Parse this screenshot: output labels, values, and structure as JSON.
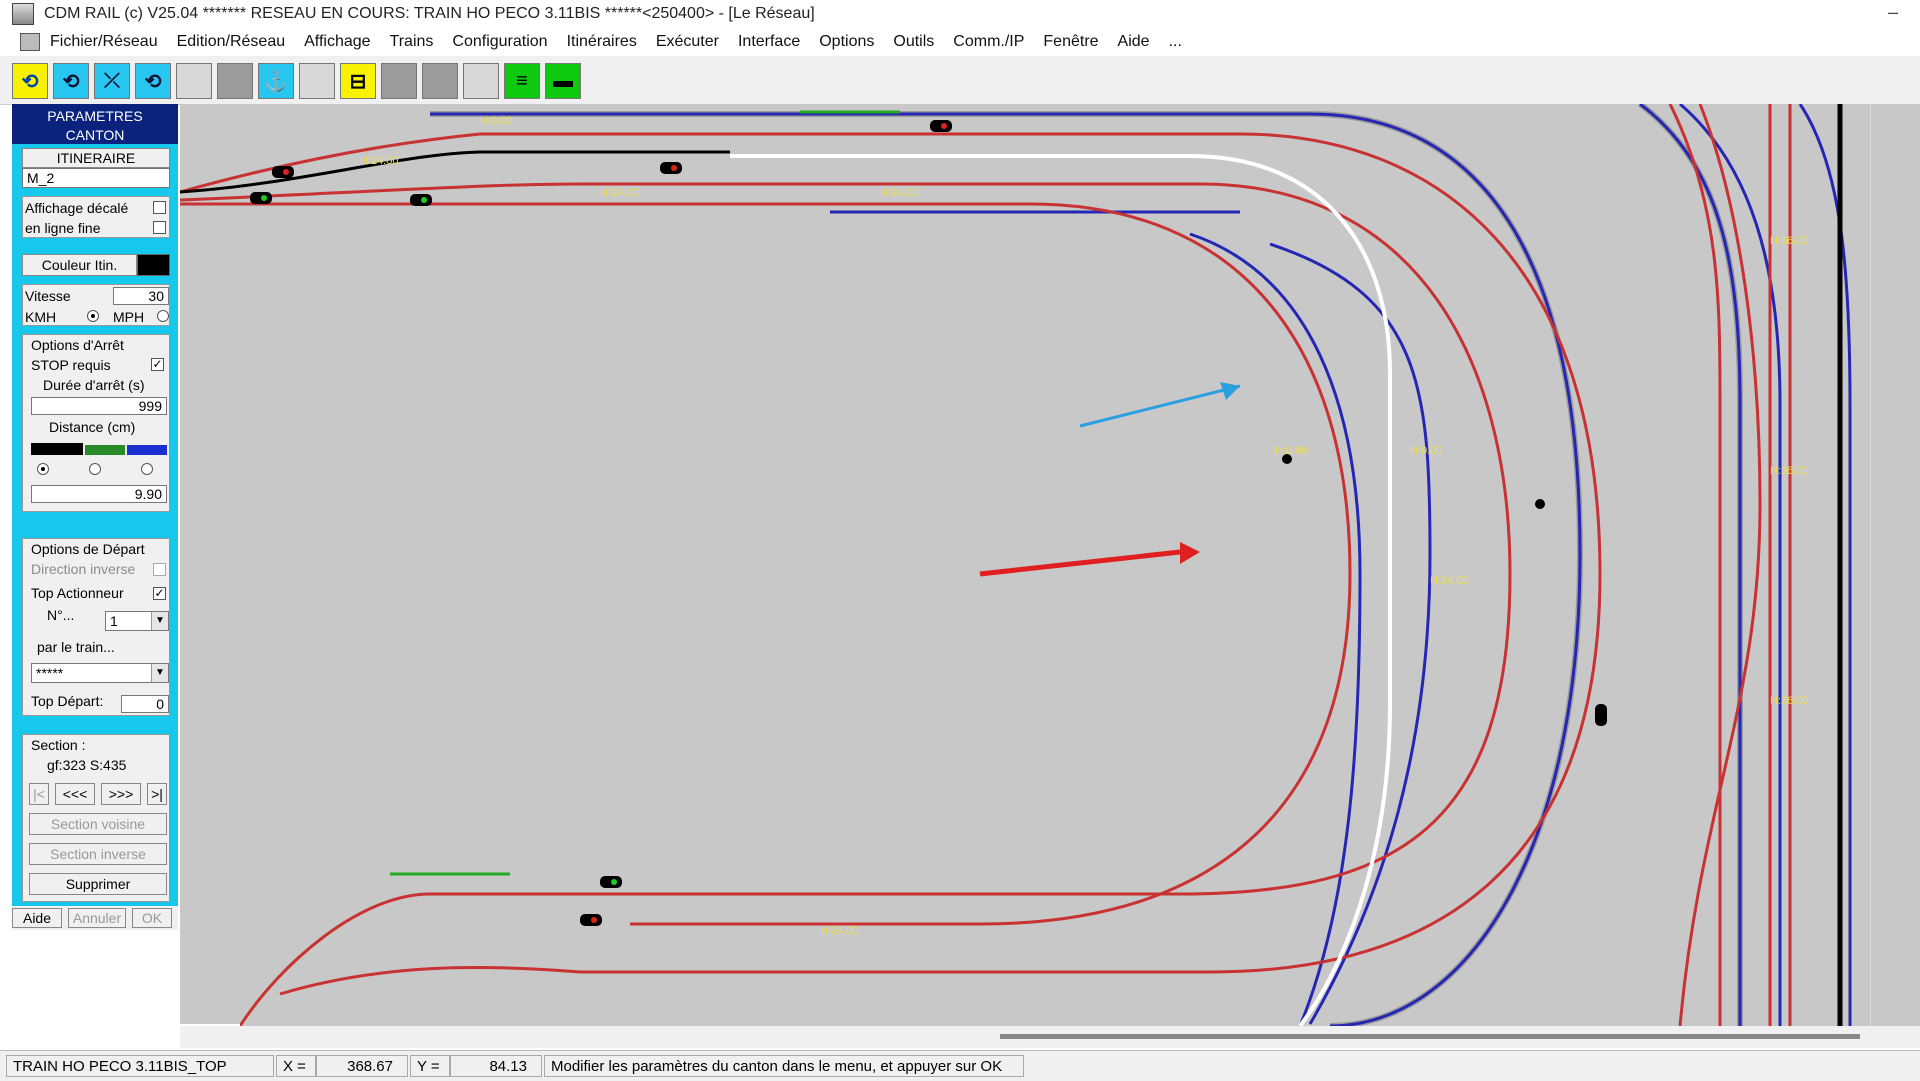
{
  "window": {
    "title": "CDM RAIL (c) V25.04     ******* RESEAU EN COURS: TRAIN HO PECO 3.11BIS ******<250400> - [Le Réseau]",
    "minimize": "–"
  },
  "menu": [
    "Fichier/Réseau",
    "Edition/Réseau",
    "Affichage",
    "Trains",
    "Configuration",
    "Itinéraires",
    "Exécuter",
    "Interface",
    "Options",
    "Outils",
    "Comm./IP",
    "Fenêtre",
    "Aide",
    "..."
  ],
  "toolbar": {
    "icons": [
      "loop-icon",
      "loop-add-icon",
      "loop-cross-icon",
      "loop-edit-icon",
      "blank-icon",
      "blank-icon",
      "anchor-icon",
      "blank-icon",
      "bracket-icon",
      "blank-icon",
      "blank-icon",
      "blank-icon",
      "lines-icon",
      "bar-icon"
    ],
    "glyphs": [
      "⟲",
      "⟲",
      "⤫",
      "⟲",
      "",
      "",
      "⚓",
      "",
      "⊟",
      "",
      "",
      "",
      "≡",
      "▬"
    ]
  },
  "panel": {
    "heading": "PARAMETRES CANTON",
    "itinerary_btn": "ITINERAIRE",
    "itinerary_name": "M_2",
    "affichage_decale": "Affichage décalé",
    "ligne_fine": "en ligne fine",
    "couleur_btn": "Couleur Itin.",
    "vitesse_label": "Vitesse",
    "vitesse_value": "30",
    "kmh": "KMH",
    "mph": "MPH",
    "options_arret": "Options d'Arrêt",
    "stop_requis": "STOP requis",
    "duree_label": "Durée d'arrêt (s)",
    "duree_value": "999",
    "distance_label": "Distance (cm)",
    "distance_value": "9.90",
    "options_depart": "Options de Départ",
    "direction_inverse": "Direction inverse",
    "top_actionneur": "Top Actionneur",
    "n_label": "N°...",
    "n_value": "1",
    "par_train": "par le train...",
    "train_value": "*****",
    "top_depart_label": "Top Départ:",
    "top_depart_value": "0",
    "section_label": "Section :",
    "section_value": "gf:323 S:435",
    "nav_first": "|<",
    "nav_prev": "<<<",
    "nav_next": ">>>",
    "nav_last": ">|",
    "section_voisine": "Section voisine",
    "section_inverse": "Section inverse",
    "supprimer": "Supprimer",
    "aide": "Aide",
    "annuler": "Annuler",
    "ok": "OK"
  },
  "status": {
    "network": "TRAIN HO PECO 3.11BIS_TOP",
    "x_label": "X =",
    "x_value": "368.67",
    "y_label": "Y =",
    "y_value": "84.13",
    "message": "Modifier les paramètres du canton dans le menu, et appuyer sur OK"
  },
  "colors": {
    "panel_bg": "#15c8ec",
    "panel_head": "#0b237c",
    "track_red": "#c83232",
    "track_blue": "#2626b4",
    "route_white": "#ffffff",
    "canvas_bg": "#c8c8c8"
  },
  "track_labels": [
    "H:0.00",
    "H:24.00",
    "H:36.00"
  ]
}
